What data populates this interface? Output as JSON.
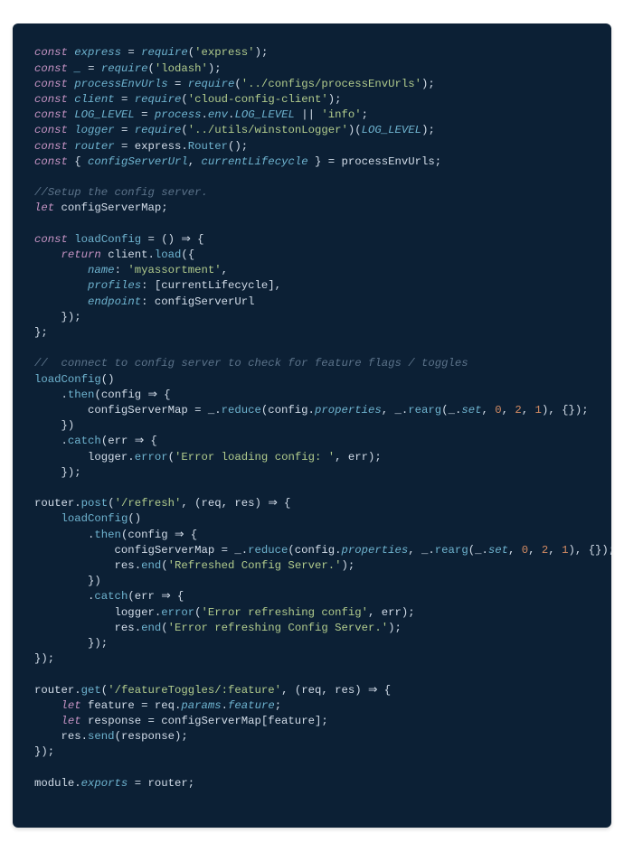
{
  "code_lines": [
    {
      "tokens": [
        [
          "kw",
          "const"
        ],
        [
          "plain",
          " "
        ],
        [
          "id",
          "express"
        ],
        [
          "plain",
          " = "
        ],
        [
          "id",
          "require"
        ],
        [
          "plain",
          "("
        ],
        [
          "str",
          "'express'"
        ],
        [
          "plain",
          ");"
        ]
      ]
    },
    {
      "tokens": [
        [
          "kw",
          "const"
        ],
        [
          "plain",
          " "
        ],
        [
          "id",
          "_"
        ],
        [
          "plain",
          " = "
        ],
        [
          "id",
          "require"
        ],
        [
          "plain",
          "("
        ],
        [
          "str",
          "'lodash'"
        ],
        [
          "plain",
          ");"
        ]
      ]
    },
    {
      "tokens": [
        [
          "kw",
          "const"
        ],
        [
          "plain",
          " "
        ],
        [
          "id",
          "processEnvUrls"
        ],
        [
          "plain",
          " = "
        ],
        [
          "id",
          "require"
        ],
        [
          "plain",
          "("
        ],
        [
          "str",
          "'../configs/processEnvUrls'"
        ],
        [
          "plain",
          ");"
        ]
      ]
    },
    {
      "tokens": [
        [
          "kw",
          "const"
        ],
        [
          "plain",
          " "
        ],
        [
          "id",
          "client"
        ],
        [
          "plain",
          " = "
        ],
        [
          "id",
          "require"
        ],
        [
          "plain",
          "("
        ],
        [
          "str",
          "'cloud-config-client'"
        ],
        [
          "plain",
          ");"
        ]
      ]
    },
    {
      "tokens": [
        [
          "kw",
          "const"
        ],
        [
          "plain",
          " "
        ],
        [
          "id",
          "LOG_LEVEL"
        ],
        [
          "plain",
          " = "
        ],
        [
          "id",
          "process"
        ],
        [
          "plain",
          "."
        ],
        [
          "prop",
          "env"
        ],
        [
          "plain",
          "."
        ],
        [
          "id",
          "LOG_LEVEL"
        ],
        [
          "plain",
          " || "
        ],
        [
          "str",
          "'info'"
        ],
        [
          "plain",
          ";"
        ]
      ]
    },
    {
      "tokens": [
        [
          "kw",
          "const"
        ],
        [
          "plain",
          " "
        ],
        [
          "id",
          "logger"
        ],
        [
          "plain",
          " = "
        ],
        [
          "id",
          "require"
        ],
        [
          "plain",
          "("
        ],
        [
          "str",
          "'../utils/winstonLogger'"
        ],
        [
          "plain",
          ")("
        ],
        [
          "id",
          "LOG_LEVEL"
        ],
        [
          "plain",
          ");"
        ]
      ]
    },
    {
      "tokens": [
        [
          "kw",
          "const"
        ],
        [
          "plain",
          " "
        ],
        [
          "id",
          "router"
        ],
        [
          "plain",
          " = express."
        ],
        [
          "fn",
          "Router"
        ],
        [
          "plain",
          "();"
        ]
      ]
    },
    {
      "tokens": [
        [
          "kw",
          "const"
        ],
        [
          "plain",
          " { "
        ],
        [
          "id",
          "configServerUrl"
        ],
        [
          "plain",
          ", "
        ],
        [
          "id",
          "currentLifecycle"
        ],
        [
          "plain",
          " } = processEnvUrls;"
        ]
      ]
    },
    {
      "tokens": [
        [
          "plain",
          ""
        ]
      ]
    },
    {
      "tokens": [
        [
          "cmt",
          "//Setup the config server."
        ]
      ]
    },
    {
      "tokens": [
        [
          "kw",
          "let"
        ],
        [
          "plain",
          " configServerMap;"
        ]
      ]
    },
    {
      "tokens": [
        [
          "plain",
          ""
        ]
      ]
    },
    {
      "tokens": [
        [
          "kw",
          "const"
        ],
        [
          "plain",
          " "
        ],
        [
          "fn",
          "loadConfig"
        ],
        [
          "plain",
          " = () => {"
        ]
      ]
    },
    {
      "tokens": [
        [
          "plain",
          "    "
        ],
        [
          "kw",
          "return"
        ],
        [
          "plain",
          " client."
        ],
        [
          "fn",
          "load"
        ],
        [
          "plain",
          "({"
        ]
      ]
    },
    {
      "tokens": [
        [
          "plain",
          "        "
        ],
        [
          "key",
          "name"
        ],
        [
          "plain",
          ": "
        ],
        [
          "str",
          "'myassortment'"
        ],
        [
          "plain",
          ","
        ]
      ]
    },
    {
      "tokens": [
        [
          "plain",
          "        "
        ],
        [
          "key",
          "profiles"
        ],
        [
          "plain",
          ": [currentLifecycle],"
        ]
      ]
    },
    {
      "tokens": [
        [
          "plain",
          "        "
        ],
        [
          "key",
          "endpoint"
        ],
        [
          "plain",
          ": configServerUrl"
        ]
      ]
    },
    {
      "tokens": [
        [
          "plain",
          "    });"
        ]
      ]
    },
    {
      "tokens": [
        [
          "plain",
          "};"
        ]
      ]
    },
    {
      "tokens": [
        [
          "plain",
          ""
        ]
      ]
    },
    {
      "tokens": [
        [
          "cmt",
          "//  connect to config server to check for feature flags / toggles"
        ]
      ]
    },
    {
      "tokens": [
        [
          "fn",
          "loadConfig"
        ],
        [
          "plain",
          "()"
        ]
      ]
    },
    {
      "tokens": [
        [
          "plain",
          "    ."
        ],
        [
          "fn",
          "then"
        ],
        [
          "plain",
          "(config => {"
        ]
      ]
    },
    {
      "tokens": [
        [
          "plain",
          "        configServerMap = _."
        ],
        [
          "fn",
          "reduce"
        ],
        [
          "plain",
          "(config."
        ],
        [
          "prop",
          "properties"
        ],
        [
          "plain",
          ", _."
        ],
        [
          "fn",
          "rearg"
        ],
        [
          "plain",
          "(_."
        ],
        [
          "prop",
          "set"
        ],
        [
          "plain",
          ", "
        ],
        [
          "num",
          "0"
        ],
        [
          "plain",
          ", "
        ],
        [
          "num",
          "2"
        ],
        [
          "plain",
          ", "
        ],
        [
          "num",
          "1"
        ],
        [
          "plain",
          "), {});"
        ]
      ]
    },
    {
      "tokens": [
        [
          "plain",
          "    })"
        ]
      ]
    },
    {
      "tokens": [
        [
          "plain",
          "    ."
        ],
        [
          "fn",
          "catch"
        ],
        [
          "plain",
          "(err => {"
        ]
      ]
    },
    {
      "tokens": [
        [
          "plain",
          "        logger."
        ],
        [
          "fn",
          "error"
        ],
        [
          "plain",
          "("
        ],
        [
          "str",
          "'Error loading config: '"
        ],
        [
          "plain",
          ", err);"
        ]
      ]
    },
    {
      "tokens": [
        [
          "plain",
          "    });"
        ]
      ]
    },
    {
      "tokens": [
        [
          "plain",
          ""
        ]
      ]
    },
    {
      "tokens": [
        [
          "plain",
          "router."
        ],
        [
          "fn",
          "post"
        ],
        [
          "plain",
          "("
        ],
        [
          "str",
          "'/refresh'"
        ],
        [
          "plain",
          ", (req, res) => {"
        ]
      ]
    },
    {
      "tokens": [
        [
          "plain",
          "    "
        ],
        [
          "fn",
          "loadConfig"
        ],
        [
          "plain",
          "()"
        ]
      ]
    },
    {
      "tokens": [
        [
          "plain",
          "        ."
        ],
        [
          "fn",
          "then"
        ],
        [
          "plain",
          "(config => {"
        ]
      ]
    },
    {
      "tokens": [
        [
          "plain",
          "            configServerMap = _."
        ],
        [
          "fn",
          "reduce"
        ],
        [
          "plain",
          "(config."
        ],
        [
          "prop",
          "properties"
        ],
        [
          "plain",
          ", _."
        ],
        [
          "fn",
          "rearg"
        ],
        [
          "plain",
          "(_."
        ],
        [
          "prop",
          "set"
        ],
        [
          "plain",
          ", "
        ],
        [
          "num",
          "0"
        ],
        [
          "plain",
          ", "
        ],
        [
          "num",
          "2"
        ],
        [
          "plain",
          ", "
        ],
        [
          "num",
          "1"
        ],
        [
          "plain",
          "), {});"
        ]
      ]
    },
    {
      "tokens": [
        [
          "plain",
          "            res."
        ],
        [
          "fn",
          "end"
        ],
        [
          "plain",
          "("
        ],
        [
          "str",
          "'Refreshed Config Server.'"
        ],
        [
          "plain",
          ");"
        ]
      ]
    },
    {
      "tokens": [
        [
          "plain",
          "        })"
        ]
      ]
    },
    {
      "tokens": [
        [
          "plain",
          "        ."
        ],
        [
          "fn",
          "catch"
        ],
        [
          "plain",
          "(err => {"
        ]
      ]
    },
    {
      "tokens": [
        [
          "plain",
          "            logger."
        ],
        [
          "fn",
          "error"
        ],
        [
          "plain",
          "("
        ],
        [
          "str",
          "'Error refreshing config'"
        ],
        [
          "plain",
          ", err);"
        ]
      ]
    },
    {
      "tokens": [
        [
          "plain",
          "            res."
        ],
        [
          "fn",
          "end"
        ],
        [
          "plain",
          "("
        ],
        [
          "str",
          "'Error refreshing Config Server.'"
        ],
        [
          "plain",
          ");"
        ]
      ]
    },
    {
      "tokens": [
        [
          "plain",
          "        });"
        ]
      ]
    },
    {
      "tokens": [
        [
          "plain",
          "});"
        ]
      ]
    },
    {
      "tokens": [
        [
          "plain",
          ""
        ]
      ]
    },
    {
      "tokens": [
        [
          "plain",
          "router."
        ],
        [
          "fn",
          "get"
        ],
        [
          "plain",
          "("
        ],
        [
          "str",
          "'/featureToggles/:feature'"
        ],
        [
          "plain",
          ", (req, res) => {"
        ]
      ]
    },
    {
      "tokens": [
        [
          "plain",
          "    "
        ],
        [
          "kw",
          "let"
        ],
        [
          "plain",
          " feature = req."
        ],
        [
          "prop",
          "params"
        ],
        [
          "plain",
          "."
        ],
        [
          "prop",
          "feature"
        ],
        [
          "plain",
          ";"
        ]
      ]
    },
    {
      "tokens": [
        [
          "plain",
          "    "
        ],
        [
          "kw",
          "let"
        ],
        [
          "plain",
          " response = configServerMap[feature];"
        ]
      ]
    },
    {
      "tokens": [
        [
          "plain",
          "    res."
        ],
        [
          "fn",
          "send"
        ],
        [
          "plain",
          "(response);"
        ]
      ]
    },
    {
      "tokens": [
        [
          "plain",
          "});"
        ]
      ]
    },
    {
      "tokens": [
        [
          "plain",
          ""
        ]
      ]
    },
    {
      "tokens": [
        [
          "plain",
          "module."
        ],
        [
          "prop",
          "exports"
        ],
        [
          "plain",
          " = router;"
        ]
      ]
    }
  ]
}
